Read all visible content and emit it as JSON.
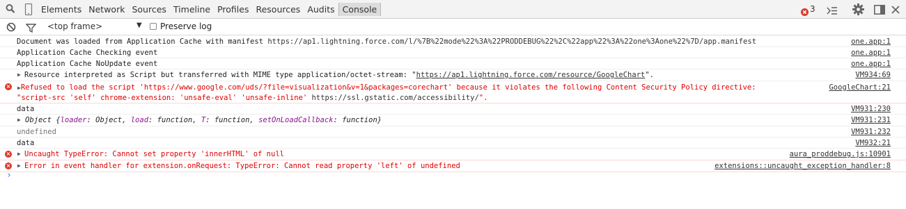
{
  "toolbar": {
    "tabs": [
      "Elements",
      "Network",
      "Sources",
      "Timeline",
      "Profiles",
      "Resources",
      "Audits",
      "Console"
    ],
    "selected_tab": "Console",
    "error_count": "3"
  },
  "filterbar": {
    "context": "<top frame>",
    "preserve_log_label": "Preserve log"
  },
  "messages": [
    {
      "text": "Document was loaded from Application Cache with manifest ",
      "url": "https://ap1.lightning.force.com/l/%7B%22mode%22%3A%22PRODDEBUG%22%2C%22app%22%3A%22one%3Aone%22%7D/app.manifest",
      "source": "one.app:1"
    },
    {
      "text": "Application Cache Checking event",
      "source": "one.app:1"
    },
    {
      "text": "Application Cache NoUpdate event",
      "source": "one.app:1"
    },
    {
      "text": "Resource interpreted as Script but transferred with MIME type application/octet-stream: \"",
      "url": "https://ap1.lightning.force.com/resource/GoogleChart",
      "text_end": "\".",
      "source": "VM934:69"
    },
    {
      "text": "Refused to load the script 'https://www.google.com/uds/?file=visualization&v=1&packages=corechart' because it violates the following Content Security Policy directive:",
      "text2": "\"script-src 'self' chrome-extension: 'unsafe-eval' 'unsafe-inline' ",
      "url2": "https://ssl.gstatic.com/accessibility/",
      "text2_end": "\".",
      "source": "GoogleChart:21"
    },
    {
      "text": "data",
      "source": "VM931:230"
    },
    {
      "text": "Object {",
      "k1": "loader",
      "v1": ": Object, ",
      "k2": "load",
      "v2": ": function, ",
      "k3": "T",
      "v3": ": function, ",
      "k4": "setOnLoadCallback",
      "v4": ": function}",
      "source": "VM931:231"
    },
    {
      "text": "undefined",
      "source": "VM931:232"
    },
    {
      "text": "data",
      "source": "VM932:21"
    },
    {
      "text": "Uncaught TypeError: Cannot set property 'innerHTML' of null",
      "source": "aura_proddebug.js:10901"
    },
    {
      "text": "Error in event handler for extension.onRequest: TypeError: Cannot read property 'left' of undefined",
      "source": "extensions::uncaught_exception_handler:8"
    }
  ],
  "prompt_glyph": "›",
  "colors": {
    "error": "#e00000",
    "link": "#333333",
    "prompt": "#367cf1"
  }
}
